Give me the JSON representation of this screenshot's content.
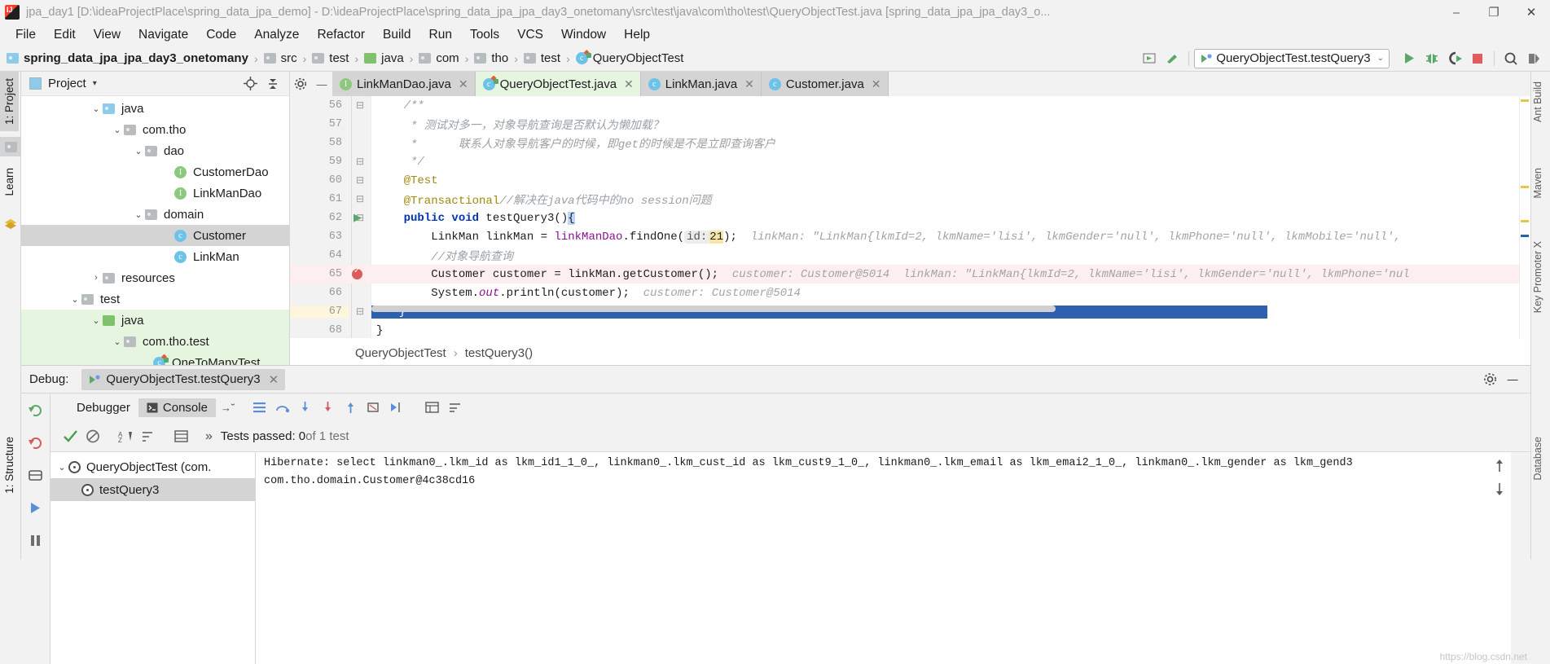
{
  "window": {
    "title": "jpa_day1 [D:\\ideaProjectPlace\\spring_data_jpa_demo] - D:\\ideaProjectPlace\\spring_data_jpa_jpa_day3_onetomany\\src\\test\\java\\com\\tho\\test\\QueryObjectTest.java [spring_data_jpa_jpa_day3_o...",
    "app_icon": "intellij-idea-icon",
    "minimize": "–",
    "maximize": "❐",
    "close": "✕"
  },
  "menu": {
    "items": [
      {
        "label": "File"
      },
      {
        "label": "Edit"
      },
      {
        "label": "View"
      },
      {
        "label": "Navigate"
      },
      {
        "label": "Code"
      },
      {
        "label": "Analyze"
      },
      {
        "label": "Refactor"
      },
      {
        "label": "Build"
      },
      {
        "label": "Run"
      },
      {
        "label": "Tools"
      },
      {
        "label": "VCS"
      },
      {
        "label": "Window"
      },
      {
        "label": "Help"
      }
    ]
  },
  "breadcrumb": {
    "separator": "›",
    "items": [
      {
        "label": "spring_data_jpa_jpa_day3_onetomany",
        "icon": "module-icon"
      },
      {
        "label": "src",
        "icon": "folder-icon"
      },
      {
        "label": "test",
        "icon": "folder-icon"
      },
      {
        "label": "java",
        "icon": "source-folder-icon"
      },
      {
        "label": "com",
        "icon": "package-icon"
      },
      {
        "label": "tho",
        "icon": "package-icon"
      },
      {
        "label": "test",
        "icon": "package-icon"
      },
      {
        "label": "QueryObjectTest",
        "icon": "test-class-icon"
      }
    ]
  },
  "toolbar": {
    "run_config": "QueryObjectTest.testQuery3",
    "chevron": "⌄",
    "run_icon": "run-icon",
    "debug_icon": "debug-icon",
    "run_coverage_icon": "run-with-coverage-icon",
    "stop_icon": "stop-icon",
    "search_icon": "search-everywhere-icon",
    "build_icon": "build-icon",
    "preview_icon": "preview-icon"
  },
  "left_strips": {
    "top": [
      {
        "label": "1: Project",
        "active": true
      },
      {
        "label": "Learn",
        "active": false
      }
    ],
    "bottom": [
      {
        "label": "1: Structure",
        "active": false
      }
    ]
  },
  "right_strips": [
    {
      "label": "Ant Build"
    },
    {
      "label": "Maven"
    },
    {
      "label": "Key Promoter X"
    },
    {
      "label": "Database"
    }
  ],
  "project_panel": {
    "title": "Project",
    "caret": "▾",
    "locate_icon": "locate-icon",
    "collapse_icon": "collapse-all-icon",
    "settings_icon": "gear-icon",
    "hide_icon": "hide-icon",
    "tree": [
      {
        "label": "java",
        "indent": 4,
        "arrow": "⌄",
        "icon": "source-folder-icon",
        "state": "normal"
      },
      {
        "label": "com.tho",
        "indent": 5,
        "arrow": "⌄",
        "icon": "package-icon",
        "state": "normal"
      },
      {
        "label": "dao",
        "indent": 6,
        "arrow": "⌄",
        "icon": "package-icon",
        "state": "normal"
      },
      {
        "label": "CustomerDao",
        "indent": 7,
        "arrow": "",
        "icon": "interface-icon",
        "state": "normal"
      },
      {
        "label": "LinkManDao",
        "indent": 7,
        "arrow": "",
        "icon": "interface-icon",
        "state": "normal"
      },
      {
        "label": "domain",
        "indent": 6,
        "arrow": "⌄",
        "icon": "package-icon",
        "state": "normal"
      },
      {
        "label": "Customer",
        "indent": 7,
        "arrow": "",
        "icon": "class-icon",
        "state": "selected"
      },
      {
        "label": "LinkMan",
        "indent": 7,
        "arrow": "",
        "icon": "class-icon",
        "state": "normal"
      },
      {
        "label": "resources",
        "indent": 4,
        "arrow": "›",
        "icon": "resources-folder-icon",
        "state": "normal"
      },
      {
        "label": "test",
        "indent": 3,
        "arrow": "⌄",
        "icon": "folder-icon",
        "state": "normal"
      },
      {
        "label": "java",
        "indent": 4,
        "arrow": "⌄",
        "icon": "test-source-folder-icon",
        "state": "green"
      },
      {
        "label": "com.tho.test",
        "indent": 5,
        "arrow": "⌄",
        "icon": "package-icon",
        "state": "green"
      },
      {
        "label": "OneToManyTest",
        "indent": 6,
        "arrow": "",
        "icon": "test-class-icon",
        "state": "green"
      }
    ]
  },
  "editor": {
    "tabs": [
      {
        "label": "LinkManDao.java",
        "icon": "interface-icon",
        "active": false,
        "close": "✕"
      },
      {
        "label": "QueryObjectTest.java",
        "icon": "test-class-icon",
        "active": true,
        "close": "✕"
      },
      {
        "label": "LinkMan.java",
        "icon": "class-icon",
        "active": false,
        "close": "✕"
      },
      {
        "label": "Customer.java",
        "icon": "class-icon",
        "active": false,
        "close": "✕"
      }
    ],
    "lines": [
      {
        "num": "56",
        "fold": "⊟",
        "segments": [
          {
            "t": "    /**",
            "c": "cmt"
          }
        ]
      },
      {
        "num": "57",
        "fold": "",
        "segments": [
          {
            "t": "     * 测试对多一，对象导航查询是否默认为懒加载？",
            "c": "cmt"
          }
        ]
      },
      {
        "num": "58",
        "fold": "",
        "segments": [
          {
            "t": "     *      联系人对象导航客户的时候，即get的时候是不是立即查询客户",
            "c": "cmt"
          }
        ]
      },
      {
        "num": "59",
        "fold": "⊟",
        "segments": [
          {
            "t": "     */",
            "c": "cmt"
          }
        ]
      },
      {
        "num": "60",
        "fold": "⊟",
        "segments": [
          {
            "t": "    @Test",
            "c": "ann"
          }
        ]
      },
      {
        "num": "61",
        "fold": "⊟",
        "segments": [
          {
            "t": "    @Transactional",
            "c": "ann"
          },
          {
            "t": "//解决在java代码中的no session问题",
            "c": "cmt"
          }
        ]
      },
      {
        "num": "62",
        "fold": "⊟",
        "runmark": true,
        "segments": [
          {
            "t": "    public void ",
            "c": "kw"
          },
          {
            "t": "testQuery3()",
            "c": "plain"
          },
          {
            "t": "{",
            "c": "caret"
          }
        ]
      },
      {
        "num": "63",
        "fold": "",
        "segments": [
          {
            "t": "        LinkMan linkMan = ",
            "c": "plain"
          },
          {
            "t": "linkManDao",
            "c": "fld"
          },
          {
            "t": ".findOne(",
            "c": "plain"
          },
          {
            "t": "id:",
            "c": "phint"
          },
          {
            "t": "21",
            "c": "numhl"
          },
          {
            "t": ");  ",
            "c": "plain"
          },
          {
            "t": "linkMan: \"LinkMan{lkmId=2, lkmName='lisi', lkmGender='null', lkmPhone='null', lkmMobile='null',",
            "c": "hint"
          }
        ]
      },
      {
        "num": "64",
        "fold": "",
        "segments": [
          {
            "t": "        //对象导航查询",
            "c": "cmt"
          }
        ]
      },
      {
        "num": "65",
        "fold": "",
        "error": true,
        "breakpoint": true,
        "segments": [
          {
            "t": "        Customer customer = linkMan.",
            "c": "plain"
          },
          {
            "t": "getCustomer",
            "c": "plain"
          },
          {
            "t": "();  ",
            "c": "plain"
          },
          {
            "t": "customer: Customer@5014  linkMan: \"LinkMan{lkmId=2, lkmName='lisi', lkmGender='null', lkmPhone='nul",
            "c": "hint"
          }
        ]
      },
      {
        "num": "66",
        "fold": "",
        "segments": [
          {
            "t": "        System.",
            "c": "plain"
          },
          {
            "t": "out",
            "c": "stat"
          },
          {
            "t": ".println(customer);  ",
            "c": "plain"
          },
          {
            "t": "customer: Customer@5014",
            "c": "hint"
          }
        ]
      },
      {
        "num": "67",
        "fold": "⊟",
        "selected": true,
        "hlnum": true,
        "segments": [
          {
            "t": "    }",
            "c": "plain"
          }
        ]
      },
      {
        "num": "68",
        "fold": "",
        "segments": [
          {
            "t": "}",
            "c": "plain"
          }
        ]
      }
    ],
    "bottom_breadcrumb": [
      "QueryObjectTest",
      "testQuery3()"
    ],
    "bottom_breadcrumb_sep": "›"
  },
  "debug": {
    "label": "Debug:",
    "session_tab": "QueryObjectTest.testQuery3",
    "session_close": "✕",
    "settings_icon": "gear-icon",
    "minimize_icon": "hide-icon",
    "tabs": [
      {
        "label": "Debugger",
        "active": false
      },
      {
        "label": "Console",
        "active": true,
        "icon": "console-icon"
      }
    ],
    "tab_pin": "→˘",
    "tests": {
      "passed_label": "Tests passed: 0",
      "of_label": " of 1 test",
      "expand_chevrons": "»",
      "ok_icon": "check-icon",
      "filter_icon": "filter-icon",
      "sort_icon": "sort-alpha-icon",
      "sort_dur_icon": "sort-duration-icon",
      "export_icon": "export-icon"
    },
    "tree": [
      {
        "label": "QueryObjectTest (com.",
        "icon": "test-class-icon",
        "indent": 0,
        "arrow": "⌄",
        "selected": false
      },
      {
        "label": "testQuery3",
        "icon": "test-method-icon",
        "indent": 1,
        "arrow": "",
        "selected": true
      }
    ],
    "console_lines": [
      "Hibernate: select linkman0_.lkm_id as lkm_id1_1_0_, linkman0_.lkm_cust_id as lkm_cust9_1_0_, linkman0_.lkm_email as lkm_emai2_1_0_, linkman0_.lkm_gender as lkm_gend3",
      "com.tho.domain.Customer@4c38cd16"
    ],
    "scroll_up_icon": "scroll-up-icon",
    "scroll_down_icon": "scroll-down-icon",
    "rail_icons": [
      "rerun-icon",
      "rerun-failed-icon",
      "toggle-icon",
      "resume-icon",
      "pause-icon"
    ]
  },
  "watermark": "https://blog.csdn.net",
  "colors": {
    "accent_green": "#59a869",
    "selection_blue": "#2d5faf",
    "tab_active_green": "#e6f5e0",
    "error_red": "#db5c5c",
    "keyword_blue": "#0033b3",
    "annotation_gold": "#9e880d",
    "comment_grey": "#9aa0a6"
  }
}
